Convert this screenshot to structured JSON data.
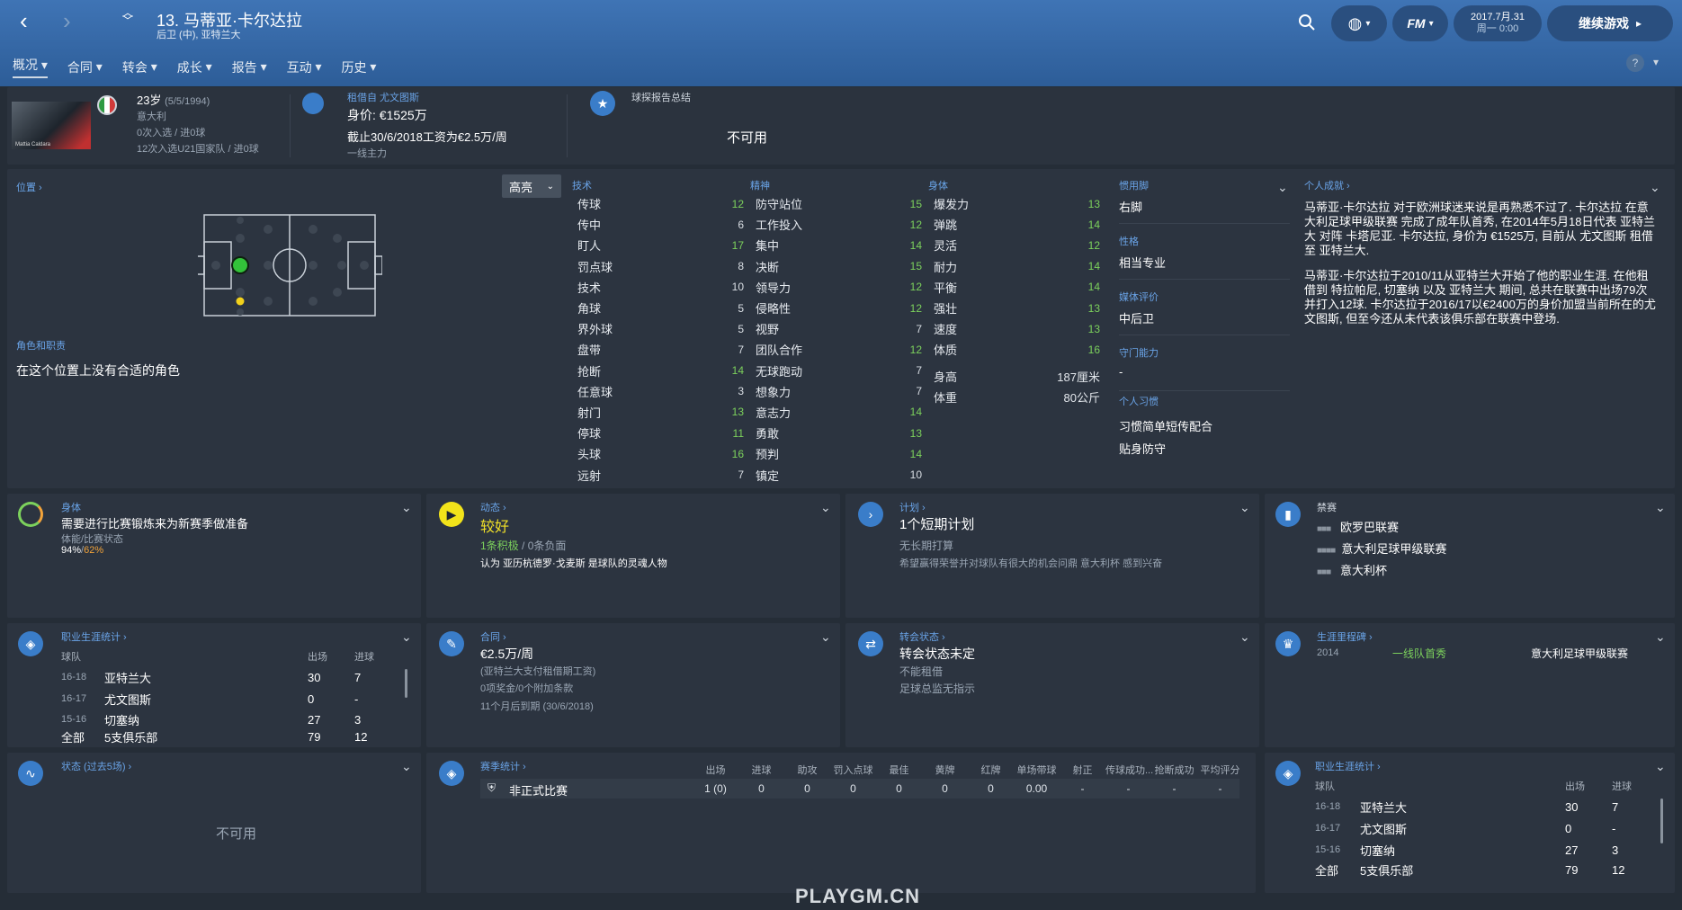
{
  "header": {
    "back_glyph": "‹",
    "forward_glyph": "›",
    "player_title": "13. 马蒂亚·卡尔达拉",
    "player_subtitle": "后卫 (中), 亚特兰大",
    "date_line1": "2017.7月.31",
    "date_line2": "周一 0:00",
    "continue_label": "继续游戏",
    "fm_label": "FM"
  },
  "tabs": [
    "概况",
    "合同",
    "转会",
    "成长",
    "报告",
    "互动",
    "历史"
  ],
  "profile": {
    "age": "23岁",
    "dob": "(5/5/1994)",
    "nation": "意大利",
    "caps": "0次入选 / 进0球",
    "u21": "12次入选U21国家队 / 进0球",
    "photo_caption": "Mattia Caldara"
  },
  "loan": {
    "title": "租借自 尤文图斯",
    "value": "身价: €1525万",
    "wage": "截止30/6/2018工资为€2.5万/周",
    "status": "一线主力"
  },
  "scout": {
    "title": "球探报告总结",
    "value": "不可用"
  },
  "position": {
    "label": "位置 ›",
    "roles_label": "角色和职责",
    "roles_text": "在这个位置上没有合适的角色",
    "highlight": "高亮"
  },
  "attrs": {
    "technical_label": "技术",
    "mental_label": "精神",
    "physical_label": "身体",
    "technical": [
      [
        "传球",
        "12"
      ],
      [
        "传中",
        "6"
      ],
      [
        "盯人",
        "17"
      ],
      [
        "罚点球",
        "8"
      ],
      [
        "技术",
        "10"
      ],
      [
        "角球",
        "5"
      ],
      [
        "界外球",
        "5"
      ],
      [
        "盘带",
        "7"
      ],
      [
        "抢断",
        "14"
      ],
      [
        "任意球",
        "3"
      ],
      [
        "射门",
        "13"
      ],
      [
        "停球",
        "11"
      ],
      [
        "头球",
        "16"
      ],
      [
        "远射",
        "7"
      ]
    ],
    "mental": [
      [
        "防守站位",
        "15"
      ],
      [
        "工作投入",
        "12"
      ],
      [
        "集中",
        "14"
      ],
      [
        "决断",
        "15"
      ],
      [
        "领导力",
        "12"
      ],
      [
        "侵略性",
        "12"
      ],
      [
        "视野",
        "7"
      ],
      [
        "团队合作",
        "12"
      ],
      [
        "无球跑动",
        "7"
      ],
      [
        "想象力",
        "7"
      ],
      [
        "意志力",
        "14"
      ],
      [
        "勇敢",
        "13"
      ],
      [
        "预判",
        "14"
      ],
      [
        "镇定",
        "10"
      ]
    ],
    "physical": [
      [
        "爆发力",
        "13"
      ],
      [
        "弹跳",
        "14"
      ],
      [
        "灵活",
        "12"
      ],
      [
        "耐力",
        "14"
      ],
      [
        "平衡",
        "14"
      ],
      [
        "强壮",
        "13"
      ],
      [
        "速度",
        "13"
      ],
      [
        "体质",
        "16"
      ]
    ],
    "height_label": "身高",
    "height": "187厘米",
    "weight_label": "体重",
    "weight": "80公斤"
  },
  "info": {
    "foot_label": "惯用脚",
    "foot": "右脚",
    "personality_label": "性格",
    "personality": "相当专业",
    "media_label": "媒体评价",
    "media": "中后卫",
    "gk_label": "守门能力",
    "gk": "-",
    "habits_label": "个人习惯",
    "habits": [
      "习惯简单短传配合",
      "贴身防守"
    ]
  },
  "bio": {
    "label": "个人成就 ›",
    "p1": "马蒂亚·卡尔达拉 对于欧洲球迷来说是再熟悉不过了. 卡尔达拉 在意大利足球甲级联赛 完成了成年队首秀, 在2014年5月18日代表 亚特兰大 对阵 卡塔尼亚. 卡尔达拉, 身价为 €1525万, 目前从 尤文图斯 租借至 亚特兰大.",
    "p2": "马蒂亚·卡尔达拉于2010/11从亚特兰大开始了他的职业生涯. 在他租借到 特拉帕尼, 切塞纳 以及 亚特兰大 期间, 总共在联赛中出场79次并打入12球. 卡尔达拉于2016/17以€2400万的身价加盟当前所在的尤文图斯, 但至今还从未代表该俱乐部在联赛中登场."
  },
  "fitness": {
    "label": "身体",
    "text": "需要进行比赛锻炼来为新赛季做准备",
    "sub": "体能/比赛状态",
    "v1": "94%",
    "slash": "/",
    "v2": "62%"
  },
  "morale": {
    "label": "动态 ›",
    "value": "较好",
    "pos": "1条积极",
    "slash": " / ",
    "neg": "0条负面",
    "note": "认为 亚历杭德罗·戈麦斯 是球队的灵魂人物"
  },
  "plans": {
    "label": "计划 ›",
    "value": "1个短期计划",
    "sub": "无长期打算",
    "note": "希望赢得荣誉并对球队有很大的机会问鼎 意大利杯 感到兴奋"
  },
  "bans": {
    "label": "禁赛",
    "items": [
      "欧罗巴联赛",
      "意大利足球甲级联赛",
      "意大利杯"
    ]
  },
  "career1": {
    "label": "职业生涯统计 ›",
    "col_team": "球队",
    "col_apps": "出场",
    "col_goals": "进球",
    "rows": [
      [
        "16-18",
        "亚特兰大",
        "30",
        "7"
      ],
      [
        "16-17",
        "尤文图斯",
        "0",
        "-"
      ],
      [
        "15-16",
        "切塞纳",
        "27",
        "3"
      ]
    ],
    "total": [
      "全部",
      "5支俱乐部",
      "79",
      "12"
    ]
  },
  "contract": {
    "label": "合同 ›",
    "wage": "€2.5万/周",
    "l1": "(亚特兰大支付租借期工资)",
    "l2": "0项奖金/0个附加条款",
    "l3": "11个月后到期",
    "l3b": "(30/6/2018)"
  },
  "transfer": {
    "label": "转会状态 ›",
    "value": "转会状态未定",
    "l1": "不能租借",
    "l2": "足球总监无指示"
  },
  "milestones": {
    "label": "生涯里程碑 ›",
    "year": "2014",
    "event": "一线队首秀",
    "comp": "意大利足球甲级联赛"
  },
  "form": {
    "label": "状态 (过去5场) ›",
    "value": "不可用"
  },
  "season": {
    "label": "赛季统计 ›",
    "headers": [
      "出场",
      "进球",
      "助攻",
      "罚入点球",
      "最佳",
      "黄牌",
      "红牌",
      "单场带球",
      "射正",
      "传球成功...",
      "抢断成功",
      "平均评分"
    ],
    "row_label": "非正式比赛",
    "values": [
      "1 (0)",
      "0",
      "0",
      "0",
      "0",
      "0",
      "0",
      "0.00",
      "-",
      "-",
      "-",
      "-"
    ]
  },
  "career2": {
    "label": "职业生涯统计 ›",
    "col_team": "球队",
    "col_apps": "出场",
    "col_goals": "进球",
    "rows": [
      [
        "16-18",
        "亚特兰大",
        "30",
        "7"
      ],
      [
        "16-17",
        "尤文图斯",
        "0",
        "-"
      ],
      [
        "15-16",
        "切塞纳",
        "27",
        "3"
      ]
    ],
    "total": [
      "全部",
      "5支俱乐部",
      "79",
      "12"
    ]
  },
  "watermark": "PLAYGM.CN",
  "colors": {
    "accent": "#3a7dc9",
    "good": "#7cd15c",
    "warn": "#f2a33a",
    "label": "#6aa4e8"
  }
}
